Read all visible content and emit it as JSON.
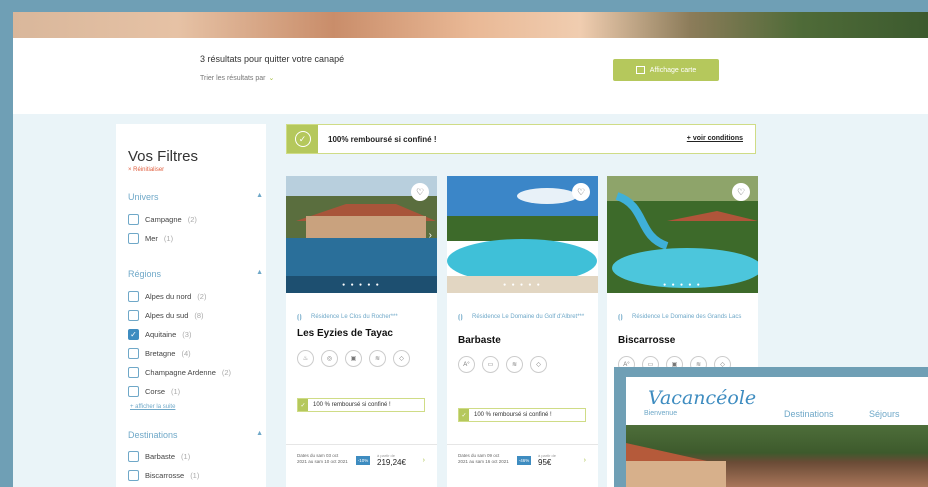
{
  "results": {
    "count_text": "3 résultats pour quitter votre canapé",
    "sort_label": "Trier les résultats par",
    "map_button": "Affichage carte"
  },
  "filters": {
    "title": "Vos Filtres",
    "reset": "× Réinitialiser",
    "univers": {
      "label": "Univers",
      "options": [
        {
          "label": "Campagne",
          "count": "(2)",
          "checked": false
        },
        {
          "label": "Mer",
          "count": "(1)",
          "checked": false
        }
      ]
    },
    "regions": {
      "label": "Régions",
      "options": [
        {
          "label": "Alpes du nord",
          "count": "(2)",
          "checked": false
        },
        {
          "label": "Alpes du sud",
          "count": "(8)",
          "checked": false
        },
        {
          "label": "Aquitaine",
          "count": "(3)",
          "checked": true
        },
        {
          "label": "Bretagne",
          "count": "(4)",
          "checked": false
        },
        {
          "label": "Champagne Ardenne",
          "count": "(2)",
          "checked": false
        },
        {
          "label": "Corse",
          "count": "(1)",
          "checked": false
        }
      ],
      "more": "+ afficher la suite"
    },
    "destinations": {
      "label": "Destinations",
      "options": [
        {
          "label": "Barbaste",
          "count": "(1)",
          "checked": false
        },
        {
          "label": "Biscarrosse",
          "count": "(1)",
          "checked": false
        }
      ]
    }
  },
  "banner": {
    "text": "100% remboursé si confiné !",
    "conditions": "+ voir conditions"
  },
  "cards": [
    {
      "residence": "Résidence Le Clos du Rocher***",
      "place": "Les Eyzies de Tayac",
      "refund": "100 % remboursé si confiné !",
      "dates": "Dates du sam 03 oct 2021 au sam 10 oct 2021",
      "discount": "-10%",
      "price": "219,24€",
      "price_caption": "à partir de"
    },
    {
      "residence": "Résidence Le Domaine du Golf d'Albret***",
      "place": "Barbaste",
      "refund": "100 % remboursé si confiné !",
      "dates": "Dates du sam 09 oct 2021 au sam 16 oct 2021",
      "discount": "-46%",
      "price": "95€",
      "price_caption": "à partir de"
    },
    {
      "residence": "Résidence Le Domaine des Grands Lacs",
      "place": "Biscarrosse"
    }
  ],
  "vacanceole": {
    "logo": "Vacancéole",
    "tagline": "Bienvenue",
    "nav": [
      "Destinations",
      "Séjours"
    ]
  }
}
